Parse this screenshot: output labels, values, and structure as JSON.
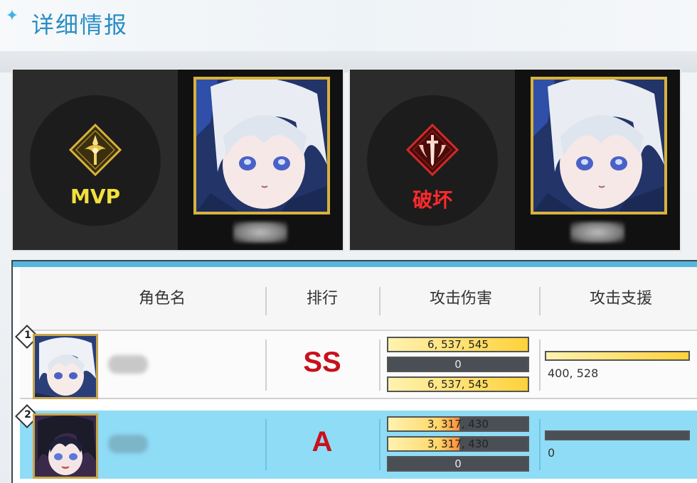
{
  "header": {
    "title": "详细情报",
    "sparkle_icon": "sparkle-icon"
  },
  "awards": [
    {
      "label": "MVP",
      "label_color": "#f3e03a",
      "emblem": "mvp-emblem-icon"
    },
    {
      "label": "破坏",
      "label_color": "#ff2a2a",
      "emblem": "sword-emblem-icon"
    }
  ],
  "table": {
    "headers": [
      "角色名",
      "排行",
      "攻击伤害",
      "攻击支援"
    ],
    "rows": [
      {
        "rank": "1",
        "grade": "SS",
        "damage": [
          {
            "label": "6, 537, 545",
            "fill": 1.0
          },
          {
            "label": "0",
            "fill": 0
          },
          {
            "label": "6, 537, 545",
            "fill": 1.0
          }
        ],
        "support": {
          "label": "400, 528",
          "fill": 1.0
        }
      },
      {
        "rank": "2",
        "grade": "A",
        "damage": [
          {
            "label": "3, 317, 430",
            "fill": 0.51
          },
          {
            "label": "3, 317, 430",
            "fill": 0.51
          },
          {
            "label": "0",
            "fill": 0
          }
        ],
        "support": {
          "label": "0",
          "fill": 0
        }
      }
    ]
  }
}
